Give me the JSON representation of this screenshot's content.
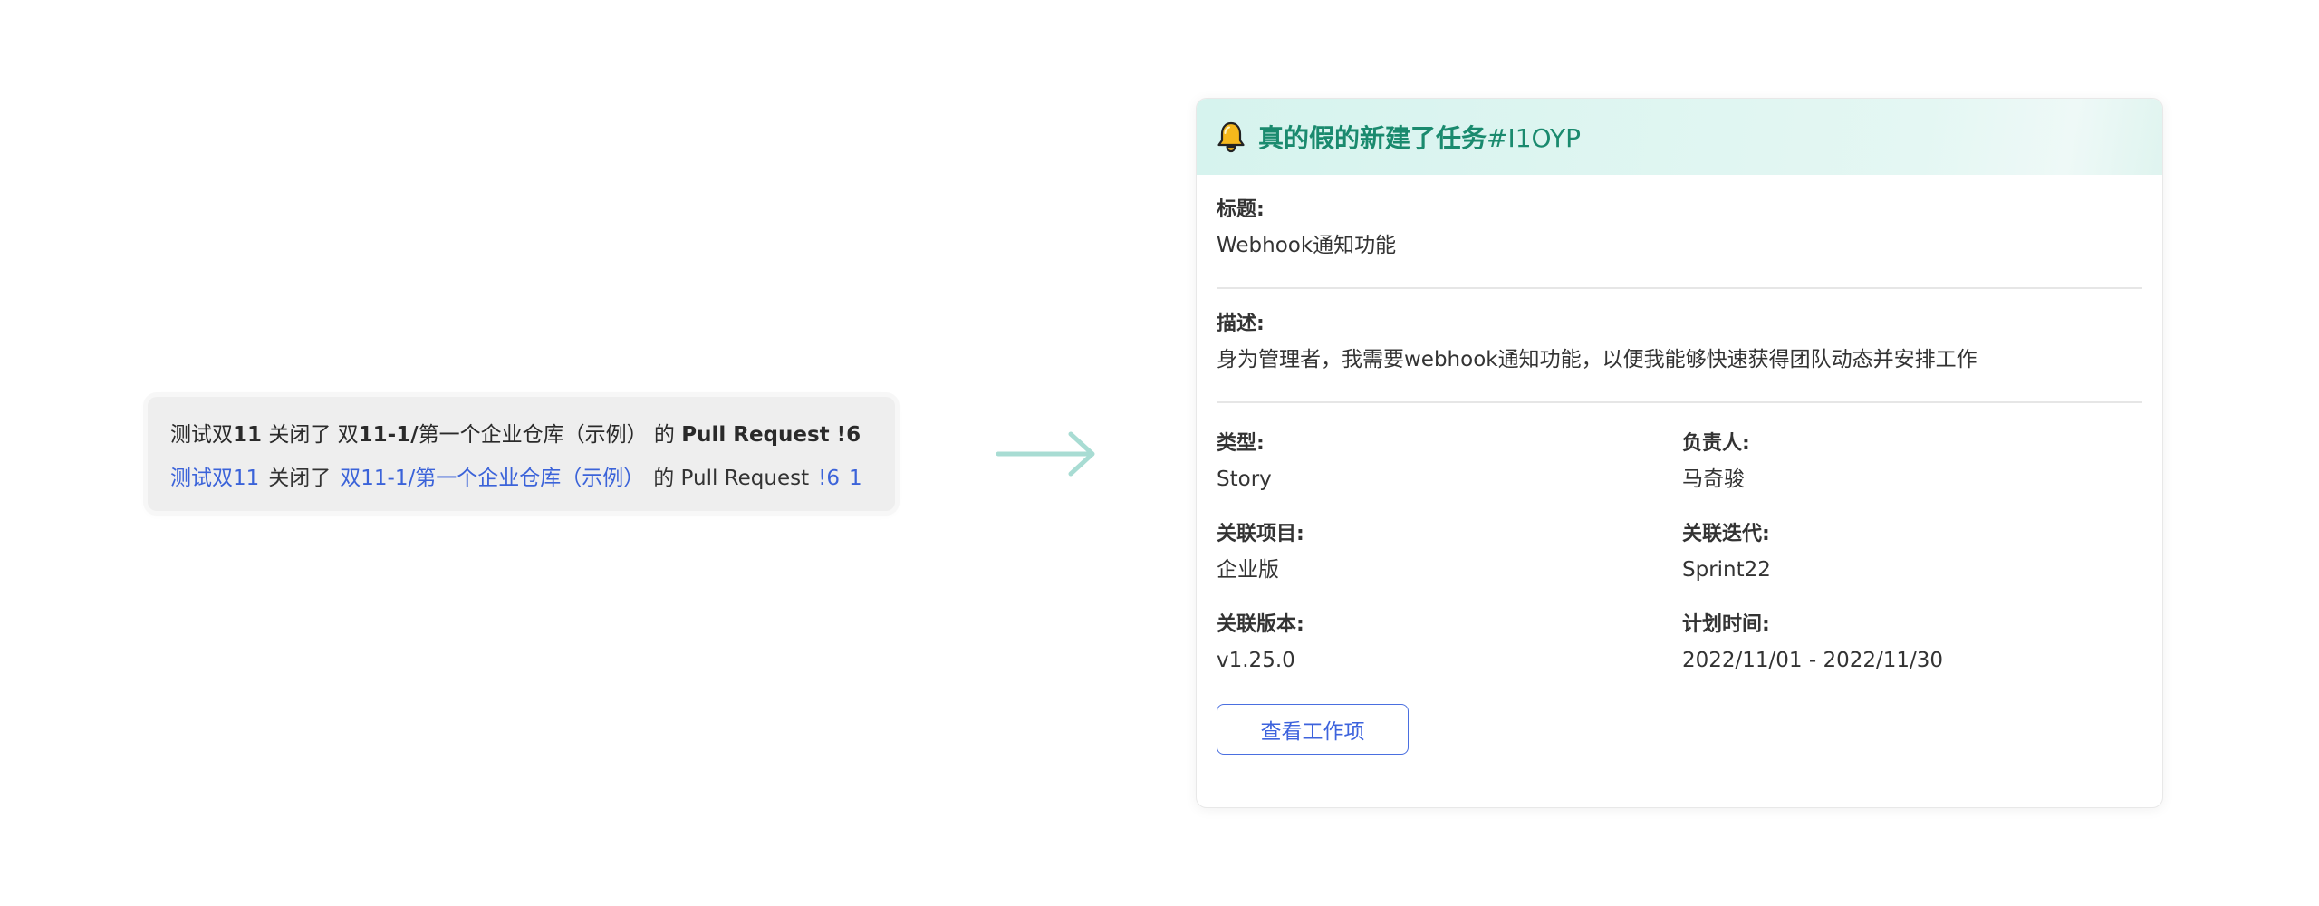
{
  "old_message": {
    "line1": {
      "p1": "测试双",
      "p2": "11",
      "p3": " 关闭了 双",
      "p4": "11-1/",
      "p5": "第一个企业仓库（示例） 的 ",
      "p6": "Pull Request !6"
    },
    "line2": {
      "user": "测试双11",
      "action": "关闭了",
      "repo": "双11-1/第一个企业仓库（示例）",
      "of": "的 Pull Request",
      "pr": "!6",
      "count": "1"
    }
  },
  "new_message": {
    "header": {
      "icon": "bell-icon",
      "title": "真的假的新建了任务",
      "issue_id": "#I1OYP",
      "accent": "#1a8a6e"
    },
    "title_label": "标题:",
    "title_value": "Webhook通知功能",
    "desc_label": "描述:",
    "desc_value": "身为管理者，我需要webhook通知功能，以便我能够快速获得团队动态并安排工作",
    "fields": [
      {
        "label": "类型:",
        "value": "Story"
      },
      {
        "label": "负责人:",
        "value": "马奇骏"
      },
      {
        "label": "关联项目:",
        "value": "企业版"
      },
      {
        "label": "关联迭代:",
        "value": "Sprint22"
      },
      {
        "label": "关联版本:",
        "value": "v1.25.0"
      },
      {
        "label": "计划时间:",
        "value": "2022/11/01 - 2022/11/30"
      }
    ],
    "button_label": "查看工作项"
  },
  "colors": {
    "link": "#3b63d9",
    "arrow": "#a8dcd3",
    "header_bg": "#d6f3ee"
  }
}
